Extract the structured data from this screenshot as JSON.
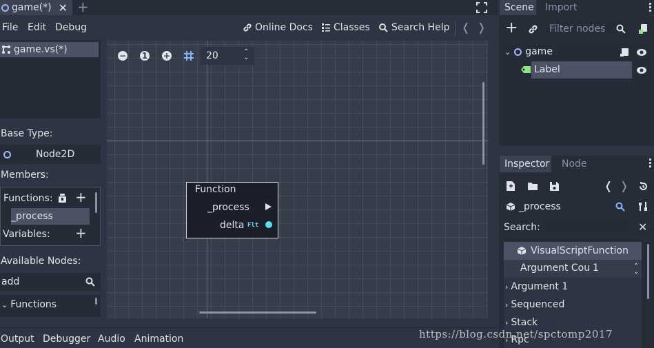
{
  "tab": {
    "title": "game(*)",
    "close": "✕",
    "add": "+"
  },
  "menu": {
    "file": "File",
    "edit": "Edit",
    "debug": "Debug"
  },
  "help": {
    "online_docs": "Online Docs",
    "classes": "Classes",
    "search_help": "Search Help"
  },
  "nav": {
    "back": "❬",
    "forward": "❭"
  },
  "left": {
    "file_item": "game.vs(*)",
    "base_type_label": "Base Type:",
    "base_type_value": "Node2D",
    "members_label": "Members:",
    "functions_label": "Functions:",
    "function_item": "_process",
    "variables_label": "Variables:",
    "available_label": "Available Nodes:",
    "search_value": "add",
    "tree_item": "Functions"
  },
  "graph": {
    "zoom_out": "−",
    "zoom_reset": "1",
    "zoom_in": "+",
    "snap_value": "20",
    "node": {
      "title": "Function",
      "port_seq": "_process",
      "port_out": "delta",
      "port_type": "Flt"
    }
  },
  "bottom": {
    "output": "Output",
    "debugger": "Debugger",
    "audio": "Audio",
    "animation": "Animation"
  },
  "scene_dock": {
    "tab_scene": "Scene",
    "tab_import": "Import",
    "filter_placeholder": "Filter nodes",
    "tree": [
      {
        "label": "game"
      },
      {
        "label": "Label"
      }
    ]
  },
  "inspector": {
    "tab_inspector": "Inspector",
    "tab_node": "Node",
    "object_name": "_process",
    "search_label": "Search:",
    "class_header": "VisualScriptFunction",
    "arg_count_label": "Argument Cou",
    "arg_count_value": "1",
    "sections": [
      "Argument 1",
      "Sequenced",
      "Stack",
      "Rpc"
    ]
  },
  "watermark": "https://blog.csdn.net/spctomp2017",
  "colors": {
    "accent": "#a5b7f3",
    "port_float": "#61daf2",
    "selection": "#4a5263",
    "background": "#2e3442"
  }
}
